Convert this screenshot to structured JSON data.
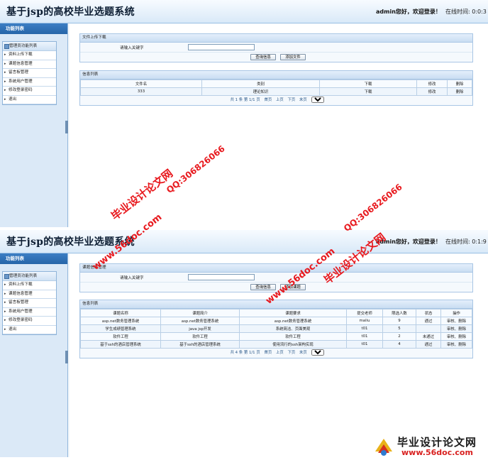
{
  "screens": [
    {
      "header": {
        "title": "基于jsp的高校毕业选题系统",
        "greeting": "admin您好，欢迎登录！",
        "online": "在线时间: 0:0:3"
      },
      "sidebar": {
        "heading": "功能列表",
        "menu_title": "管理员功能列表",
        "items": [
          "资料上传下载",
          "课题信息管理",
          "留言板管理",
          "系统用户管理",
          "修改登录密码",
          "退出"
        ]
      },
      "search_panel": {
        "title": "文件上传下载",
        "label": "请输入关键字",
        "input_value": "",
        "query_button": "查询信息",
        "add_button": "添加文件"
      },
      "list_panel": {
        "title": "信息列表",
        "columns": [
          "文件名",
          "类别",
          "下载",
          "修改",
          "删除"
        ],
        "rows": [
          [
            "333",
            "理论知识",
            "下载",
            "修改",
            "删除"
          ]
        ],
        "pager": {
          "summary": "共 1 条 第 1/1 页",
          "first": "首页",
          "prev": "上页",
          "next": "下页",
          "last": "末页",
          "page_select": "1"
        }
      }
    },
    {
      "header": {
        "title": "基于jsp的高校毕业选题系统",
        "greeting": "admin您好，欢迎登录！",
        "online": "在线时间: 0:1:9"
      },
      "sidebar": {
        "heading": "功能列表",
        "menu_title": "管理员功能列表",
        "items": [
          "资料上传下载",
          "课题信息管理",
          "留言板管理",
          "系统用户管理",
          "修改登录密码",
          "退出"
        ]
      },
      "search_panel": {
        "title": "课题信息管理",
        "label": "请输入关键字",
        "input_value": "",
        "query_button": "查询信息",
        "add_button": "添加课题"
      },
      "list_panel": {
        "title": "信息列表",
        "columns": [
          "课题名称",
          "课题简介",
          "课题要求",
          "提交老师",
          "限选人数",
          "状态",
          "操作"
        ],
        "rows": [
          [
            "asp.net数务管理系统",
            "asp.net数务管理系统",
            "asp.net数务管理系统",
            "maliu",
            "9",
            "通过",
            "审核、删除"
          ],
          [
            "学生成绩管理系统",
            "java jsp开发",
            "系统简洁、页面美观",
            "t01",
            "5",
            "",
            "审核、删除"
          ],
          [
            "软件工程",
            "软件工程",
            "软件工程",
            "t01",
            "2",
            "未通过",
            "审核、删除"
          ],
          [
            "基于ssh的酒店管理系统",
            "基于ssh的酒店管理系统",
            "使用流行的ssh架构实现",
            "t01",
            "4",
            "通过",
            "审核、删除"
          ]
        ],
        "pager": {
          "summary": "共 4 条 第 1/1 页",
          "first": "首页",
          "prev": "上页",
          "next": "下页",
          "last": "末页",
          "page_select": "1"
        }
      }
    }
  ],
  "watermarks": {
    "cn": "毕业设计论文网",
    "qq": "QQ:306826066",
    "url": "www.56doc.com",
    "color": "#e8191e"
  },
  "logo": {
    "title": "毕业设计论文网",
    "url": "www.56doc.com"
  }
}
